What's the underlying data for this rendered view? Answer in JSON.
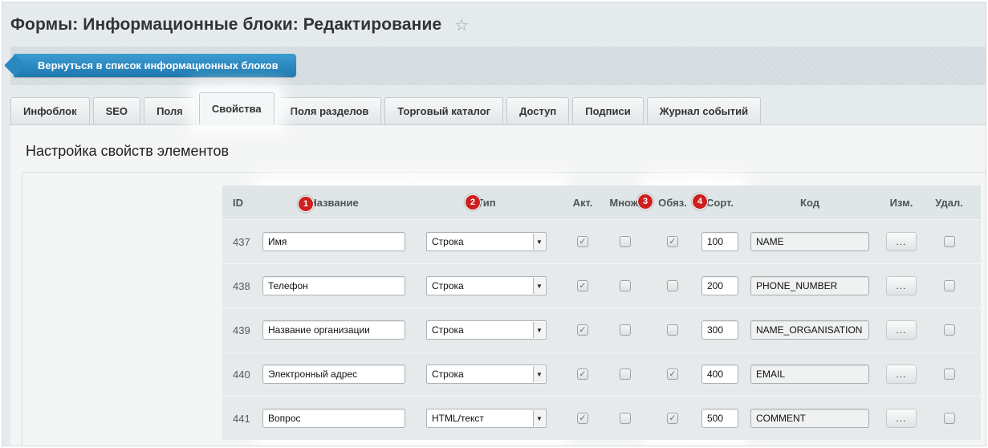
{
  "page": {
    "title": "Формы: Информационные блоки: Редактирование",
    "star_icon": "star-icon"
  },
  "toolbar": {
    "back_label": "Вернуться в список информационных блоков"
  },
  "tabs": [
    {
      "label": "Инфоблок"
    },
    {
      "label": "SEO"
    },
    {
      "label": "Поля"
    },
    {
      "label": "Свойства",
      "active": true
    },
    {
      "label": "Поля разделов"
    },
    {
      "label": "Торговый каталог"
    },
    {
      "label": "Доступ"
    },
    {
      "label": "Подписи"
    },
    {
      "label": "Журнал событий"
    }
  ],
  "panel": {
    "title": "Настройка свойств элементов"
  },
  "table": {
    "columns": {
      "id": "ID",
      "name": "Название",
      "type": "Тип",
      "active": "Акт.",
      "multiple": "Множ.",
      "required": "Обяз.",
      "sort": "Сорт.",
      "code": "Код",
      "edit": "Изм.",
      "delete": "Удал."
    },
    "badges": [
      "1",
      "2",
      "3",
      "4"
    ],
    "edit_button_label": "...",
    "rows": [
      {
        "id": "437",
        "name": "Имя",
        "type": "Строка",
        "active": true,
        "multiple": false,
        "required": true,
        "sort": "100",
        "code": "NAME",
        "delete": false
      },
      {
        "id": "438",
        "name": "Телефон",
        "type": "Строка",
        "active": true,
        "multiple": false,
        "required": false,
        "sort": "200",
        "code": "PHONE_NUMBER",
        "delete": false
      },
      {
        "id": "439",
        "name": "Название организации",
        "type": "Строка",
        "active": true,
        "multiple": false,
        "required": false,
        "sort": "300",
        "code": "NAME_ORGANISATION",
        "delete": false
      },
      {
        "id": "440",
        "name": "Электронный адрес",
        "type": "Строка",
        "active": true,
        "multiple": false,
        "required": true,
        "sort": "400",
        "code": "EMAIL",
        "delete": false
      },
      {
        "id": "441",
        "name": "Вопрос",
        "type": "HTML/текст",
        "active": true,
        "multiple": false,
        "required": true,
        "sort": "500",
        "code": "COMMENT",
        "delete": false
      }
    ]
  },
  "colors": {
    "accent": "#2a89c0",
    "badge": "#cd1f1f",
    "panel_bg": "#f4f5f5",
    "header_bg": "#e0e6e8"
  }
}
